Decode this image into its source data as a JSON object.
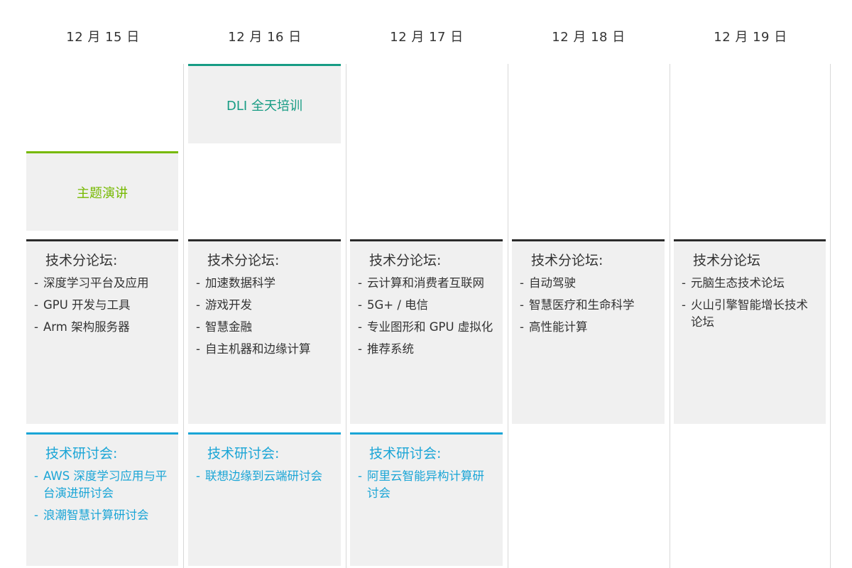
{
  "days": [
    {
      "date": "12 月 15 日"
    },
    {
      "date": "12 月 16 日"
    },
    {
      "date": "12 月 17 日"
    },
    {
      "date": "12 月 18 日"
    },
    {
      "date": "12 月 19 日"
    }
  ],
  "colors": {
    "keynote": "#76b900",
    "dli": "#179c84",
    "forum_border": "#2b2b2b",
    "workshop": "#1aa5d6",
    "block_bg": "#f0f0f0"
  },
  "keynote": {
    "title": "主题演讲"
  },
  "dli": {
    "title": "DLI 全天培训"
  },
  "forums": [
    {
      "heading": "技术分论坛:",
      "items": [
        "深度学习平台及应用",
        "GPU 开发与工具",
        "Arm 架构服务器"
      ]
    },
    {
      "heading": "技术分论坛:",
      "items": [
        "加速数据科学",
        "游戏开发",
        "智慧金融",
        "自主机器和边缘计算"
      ]
    },
    {
      "heading": "技术分论坛:",
      "items": [
        "云计算和消费者互联网",
        "5G+ / 电信",
        "专业图形和 GPU 虚拟化",
        "推荐系统"
      ]
    },
    {
      "heading": "技术分论坛:",
      "items": [
        "自动驾驶",
        "智慧医疗和生命科学",
        "高性能计算"
      ]
    },
    {
      "heading": "技术分论坛",
      "items": [
        "元脑生态技术论坛",
        "火山引擎智能增长技术论坛"
      ]
    }
  ],
  "workshops": [
    {
      "heading": "技术研讨会:",
      "items": [
        "AWS 深度学习应用与平台演进研讨会",
        "浪潮智慧计算研讨会"
      ]
    },
    {
      "heading": "技术研讨会:",
      "items": [
        "联想边缘到云端研讨会"
      ]
    },
    {
      "heading": "技术研讨会:",
      "items": [
        "阿里云智能异构计算研讨会"
      ]
    }
  ]
}
